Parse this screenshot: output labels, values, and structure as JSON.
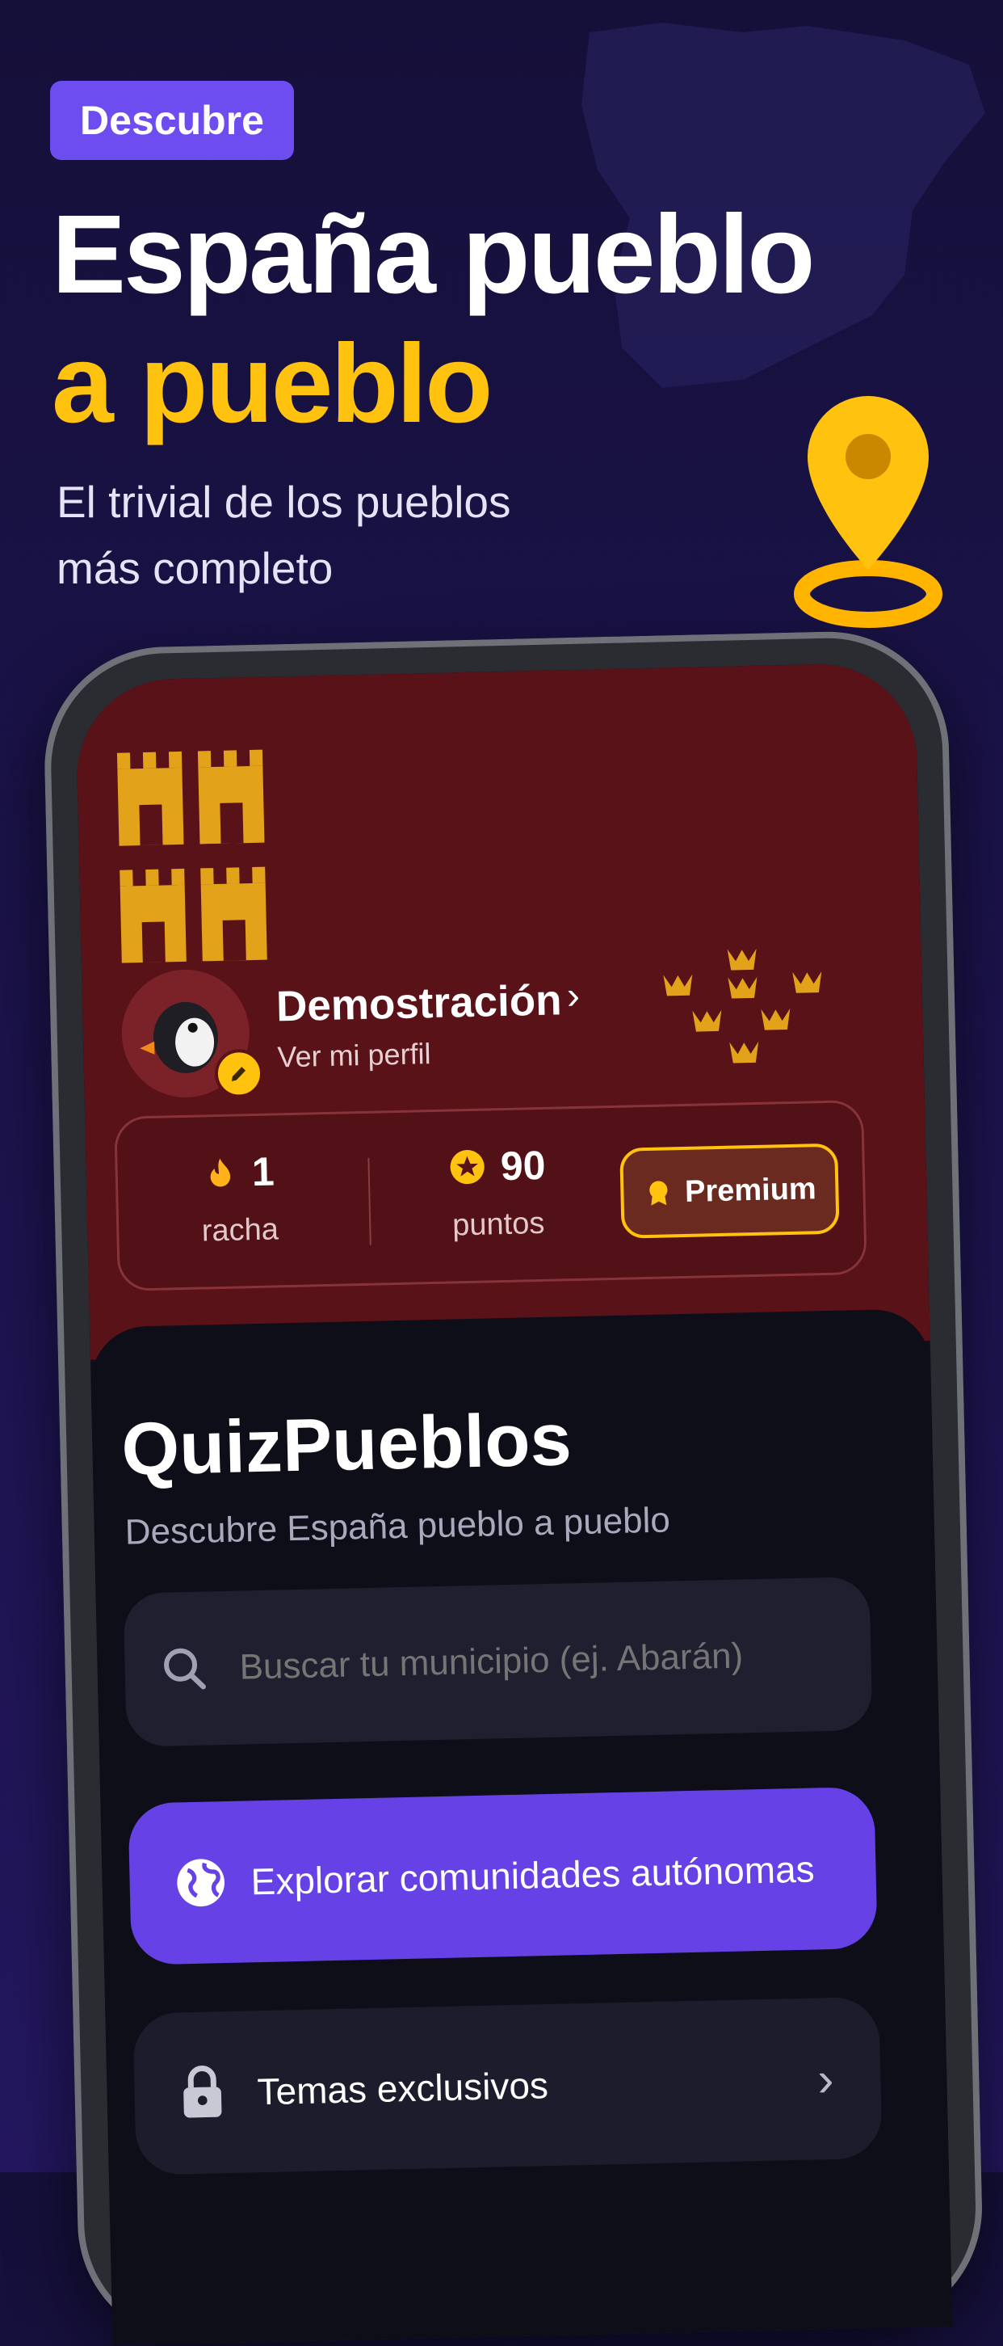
{
  "promo": {
    "badge": "Descubre",
    "headline_line1": "España pueblo",
    "headline_line2": "a pueblo",
    "subtitle_line1": "El trivial de los pueblos",
    "subtitle_line2": "más completo"
  },
  "profile": {
    "name": "Demostración",
    "link": "Ver mi perfil"
  },
  "stats": {
    "streak_value": "1",
    "streak_label": "racha",
    "points_value": "90",
    "points_label": "puntos",
    "premium_label": "Premium"
  },
  "app": {
    "title": "QuizPueblos",
    "subtitle": "Descubre España pueblo a pueblo",
    "search_placeholder": "Buscar tu municipio (ej. Abarán)",
    "explore_label": "Explorar comunidades autónomas",
    "themes_label": "Temas exclusivos"
  },
  "colors": {
    "accent_purple": "#6d4cf0",
    "accent_yellow": "#ffc20e",
    "hero_red": "#5a1219",
    "background": "#15103a"
  },
  "icons": [
    "map-pin-icon",
    "castle-icon",
    "crown-icon",
    "penguin-avatar",
    "pencil-icon",
    "flame-icon",
    "star-icon",
    "medal-icon",
    "search-icon",
    "globe-icon",
    "lock-icon",
    "chevron-right-icon"
  ]
}
